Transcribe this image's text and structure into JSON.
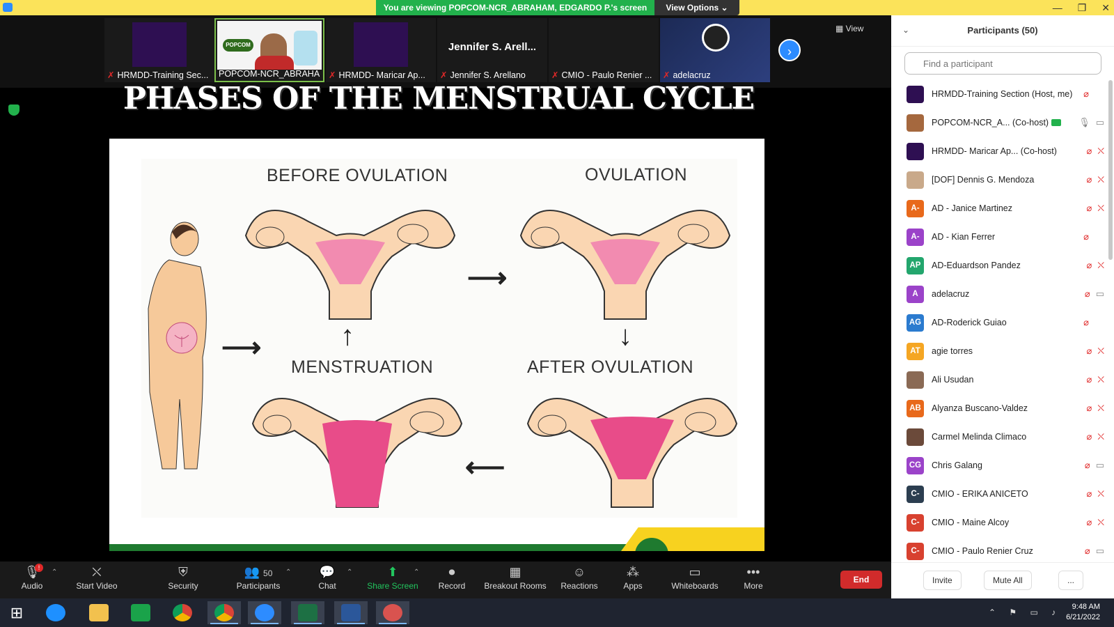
{
  "titlebar": {
    "banner": "You are viewing POPCOM-NCR_ABRAHAM, EDGARDO P.'s screen",
    "view_options": "View Options ⌄"
  },
  "strip": {
    "thumbnails": [
      {
        "caption": "HRMDD-Training Sec...",
        "kind": "tile"
      },
      {
        "caption": "POPCOM-NCR_ABRAHA...",
        "kind": "video"
      },
      {
        "caption": "HRMDD- Maricar Ap...",
        "kind": "tile"
      },
      {
        "caption": "Jennifer S. Arellano",
        "name_text": "Jennifer S. Arell...",
        "kind": "name"
      },
      {
        "caption": "CMIO - Paulo Renier ...",
        "kind": "blank"
      },
      {
        "caption": "adelacruz",
        "kind": "obs"
      }
    ],
    "logo_text": "POPCOM",
    "view_label": "View"
  },
  "slide": {
    "title": "PHASES OF THE MENSTRUAL CYCLE",
    "labels": {
      "before": "BEFORE OVULATION",
      "ovulation": "OVULATION",
      "menstruation": "MENSTRUATION",
      "after": "AFTER OVULATION"
    }
  },
  "panel": {
    "title": "Participants (50)",
    "search_placeholder": "Find a participant",
    "participants": [
      {
        "name": "HRMDD-Training Section (Host, me)",
        "initials": "",
        "color": "#2e0f52",
        "mic": "off",
        "cam": ""
      },
      {
        "name": "POPCOM-NCR_A... (Co-host)",
        "initials": "",
        "color": "#a5683e",
        "mic": "on",
        "cam": "on",
        "sharing": true
      },
      {
        "name": "HRMDD- Maricar Ap... (Co-host)",
        "initials": "",
        "color": "#2e0f52",
        "mic": "off",
        "cam": "off"
      },
      {
        "name": "[DOF] Dennis G. Mendoza",
        "initials": "",
        "color": "#c9a98a",
        "mic": "off",
        "cam": "off"
      },
      {
        "name": "AD - Janice Martinez",
        "initials": "A-",
        "color": "#e8691b",
        "mic": "off",
        "cam": "off"
      },
      {
        "name": "AD - Kian Ferrer",
        "initials": "A-",
        "color": "#9b43c9",
        "mic": "off",
        "cam": ""
      },
      {
        "name": "AD-Eduardson Pandez",
        "initials": "AP",
        "color": "#23a66d",
        "mic": "off",
        "cam": "off"
      },
      {
        "name": "adelacruz",
        "initials": "A",
        "color": "#9b43c9",
        "mic": "off",
        "cam": "on"
      },
      {
        "name": "AD-Roderick Guiao",
        "initials": "AG",
        "color": "#2b7bcf",
        "mic": "off",
        "cam": ""
      },
      {
        "name": "agie torres",
        "initials": "AT",
        "color": "#f5a623",
        "mic": "off",
        "cam": "off"
      },
      {
        "name": "Ali Usudan",
        "initials": "",
        "color": "#8a6a55",
        "mic": "off",
        "cam": "off"
      },
      {
        "name": "Alyanza Buscano-Valdez",
        "initials": "AB",
        "color": "#e8691b",
        "mic": "off",
        "cam": "off"
      },
      {
        "name": "Carmel Melinda Climaco",
        "initials": "",
        "color": "#6b4a3a",
        "mic": "off",
        "cam": "off"
      },
      {
        "name": "Chris Galang",
        "initials": "CG",
        "color": "#9b43c9",
        "mic": "off",
        "cam": "on"
      },
      {
        "name": "CMIO - ERIKA ANICETO",
        "initials": "C-",
        "color": "#2c3e50",
        "mic": "off",
        "cam": "off"
      },
      {
        "name": "CMIO - Maine Alcoy",
        "initials": "C-",
        "color": "#d8412f",
        "mic": "off",
        "cam": "off"
      },
      {
        "name": "CMIO - Paulo Renier Cruz",
        "initials": "C-",
        "color": "#d8412f",
        "mic": "off",
        "cam": "on"
      }
    ],
    "footer": {
      "invite": "Invite",
      "mute_all": "Mute All",
      "more": "..."
    }
  },
  "controls": {
    "audio": "Audio",
    "start_video": "Start Video",
    "security": "Security",
    "participants": "Participants",
    "participants_count": "50",
    "chat": "Chat",
    "share_screen": "Share Screen",
    "record": "Record",
    "breakout_rooms": "Breakout Rooms",
    "reactions": "Reactions",
    "apps": "Apps",
    "whiteboards": "Whiteboards",
    "more": "More",
    "end": "End",
    "audio_badge": "!"
  },
  "taskbar": {
    "time": "9:48 AM",
    "date": "6/21/2022"
  }
}
